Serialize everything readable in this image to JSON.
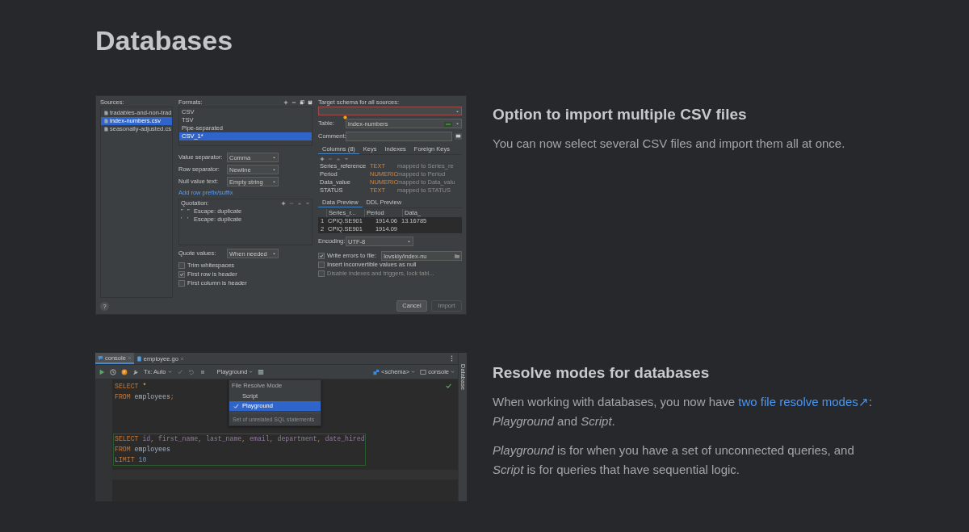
{
  "title": "Databases",
  "features": [
    {
      "heading": "Option to import multiple CSV files",
      "paragraphs": [
        [
          {
            "text": "You can now select several CSV files and import them all at once."
          }
        ]
      ]
    },
    {
      "heading": "Resolve modes for databases",
      "paragraphs": [
        [
          {
            "text": "When working with databases, you now have "
          },
          {
            "text": "two file resolve modes↗",
            "kind": "link"
          },
          {
            "text": ": *Playground* and *Script*."
          }
        ],
        [
          {
            "text": "*Playground* is for when you have a set of unconnected queries, and *Script* is for queries that have sequential logic."
          }
        ]
      ]
    }
  ],
  "import_dialog": {
    "sources": {
      "label": "Sources:",
      "items": [
        {
          "name": "tradables-and-non-trad",
          "selected": false
        },
        {
          "name": "index-numbers.csv",
          "selected": true
        },
        {
          "name": "seasonally-adjusted.cs",
          "selected": false
        }
      ]
    },
    "formats": {
      "label": "Formats:",
      "items": [
        {
          "name": "CSV",
          "selected": false
        },
        {
          "name": "TSV",
          "selected": false
        },
        {
          "name": "Pipe-separated",
          "selected": false
        },
        {
          "name": "CSV_1*",
          "selected": true
        }
      ]
    },
    "settings": [
      {
        "label": "Value separator:",
        "value": "Comma"
      },
      {
        "label": "Row separator:",
        "value": "Newline"
      },
      {
        "label": "Null value text:",
        "value": "Empty string"
      }
    ],
    "prefix_link": "Add row prefix/suffix",
    "quotation": {
      "label": "Quotation:",
      "rows": [
        {
          "open": "\"",
          "close": "\"",
          "escape": "Escape: duplicate"
        },
        {
          "open": "'",
          "close": "'",
          "escape": "Escape: duplicate"
        }
      ]
    },
    "quote_values": {
      "label": "Quote values:",
      "value": "When needed"
    },
    "options": [
      {
        "label": "Trim whitespaces",
        "checked": false
      },
      {
        "label": "First row is header",
        "checked": true
      },
      {
        "label": "First column is header",
        "checked": false
      }
    ],
    "help": "?",
    "target_schema": {
      "label": "Target schema for all sources:",
      "error": true
    },
    "table": {
      "label": "Table:",
      "value": "index-numbers"
    },
    "comment": {
      "label": "Comment:"
    },
    "column_tabs": [
      {
        "label": "Columns (8)",
        "selected": true
      },
      {
        "label": "Keys",
        "selected": false
      },
      {
        "label": "Indexes",
        "selected": false
      },
      {
        "label": "Foreign Keys",
        "selected": false
      }
    ],
    "columns": [
      {
        "name": "Series_reference",
        "type": "TEXT",
        "mapping": "mapped to Series_re"
      },
      {
        "name": "Period",
        "type": "NUMERIC",
        "mapping": "mapped to Period"
      },
      {
        "name": "Data_value",
        "type": "NUMERIC",
        "mapping": "mapped to Data_valu"
      },
      {
        "name": "STATUS",
        "type": "TEXT",
        "mapping": "mapped to STATUS"
      }
    ],
    "preview_tabs": [
      {
        "label": "Data Preview",
        "selected": true
      },
      {
        "label": "DDL Preview",
        "selected": false
      }
    ],
    "preview": {
      "columns": [
        "",
        "Series_r...",
        "Period",
        "Data_"
      ],
      "rows": [
        [
          "1",
          "CPIQ.SE901",
          "1914.06",
          "13.16785"
        ],
        [
          "2",
          "CPIQ.SE901",
          "1914.09"
        ]
      ]
    },
    "encoding": {
      "label": "Encoding:",
      "value": "UTF-8"
    },
    "write_errors": {
      "label": "Write errors to file:",
      "checked": true,
      "path": "lovskiy/index-nu"
    },
    "extra_options": [
      {
        "label": "Insert inconvertible values as null",
        "checked": false,
        "disabled": false
      },
      {
        "label": "Disable indexes and triggers, lock tabl...",
        "checked": false,
        "disabled": true
      }
    ],
    "buttons": [
      {
        "label": "Cancel",
        "disabled": false
      },
      {
        "label": "Import",
        "disabled": true
      }
    ]
  },
  "console_window": {
    "tabs": [
      {
        "label": "console",
        "selected": true
      },
      {
        "label": "employee.go",
        "selected": false
      }
    ],
    "tx": "Tx: Auto",
    "mode": "Playground",
    "schema": "<schema>",
    "session": "console",
    "side_tab": "Database",
    "statements": [
      {
        "highlighted": false,
        "lines": [
          [
            {
              "text": "SELECT",
              "kind": "keyword"
            },
            {
              "text": " *",
              "kind": "star"
            }
          ],
          [
            {
              "text": "FROM",
              "kind": "keyword"
            },
            {
              "text": " employees",
              "kind": "table"
            },
            {
              "text": ";",
              "kind": "punct"
            }
          ]
        ]
      },
      {
        "highlighted": true,
        "lines": [
          [
            {
              "text": "SELECT",
              "kind": "keyword"
            },
            {
              "text": " id",
              "kind": "column"
            },
            {
              "text": ",",
              "kind": "punct"
            },
            {
              "text": " first_name",
              "kind": "column"
            },
            {
              "text": ",",
              "kind": "punct"
            },
            {
              "text": " last_name",
              "kind": "column"
            },
            {
              "text": ",",
              "kind": "punct"
            },
            {
              "text": " email",
              "kind": "column"
            },
            {
              "text": ",",
              "kind": "punct"
            },
            {
              "text": " department",
              "kind": "column"
            },
            {
              "text": ",",
              "kind": "punct"
            },
            {
              "text": " date_hired",
              "kind": "column"
            }
          ],
          [
            {
              "text": "FROM",
              "kind": "keyword"
            },
            {
              "text": " employees",
              "kind": "table"
            }
          ],
          [
            {
              "text": "LIMIT",
              "kind": "keyword"
            },
            {
              "text": " 10",
              "kind": "number"
            }
          ]
        ]
      }
    ],
    "menu": {
      "title": "File Resolve Mode",
      "items": [
        {
          "label": "Script",
          "selected": false
        },
        {
          "label": "Playground",
          "selected": true
        }
      ],
      "hint": "Set of unrelated SQL statements"
    }
  }
}
